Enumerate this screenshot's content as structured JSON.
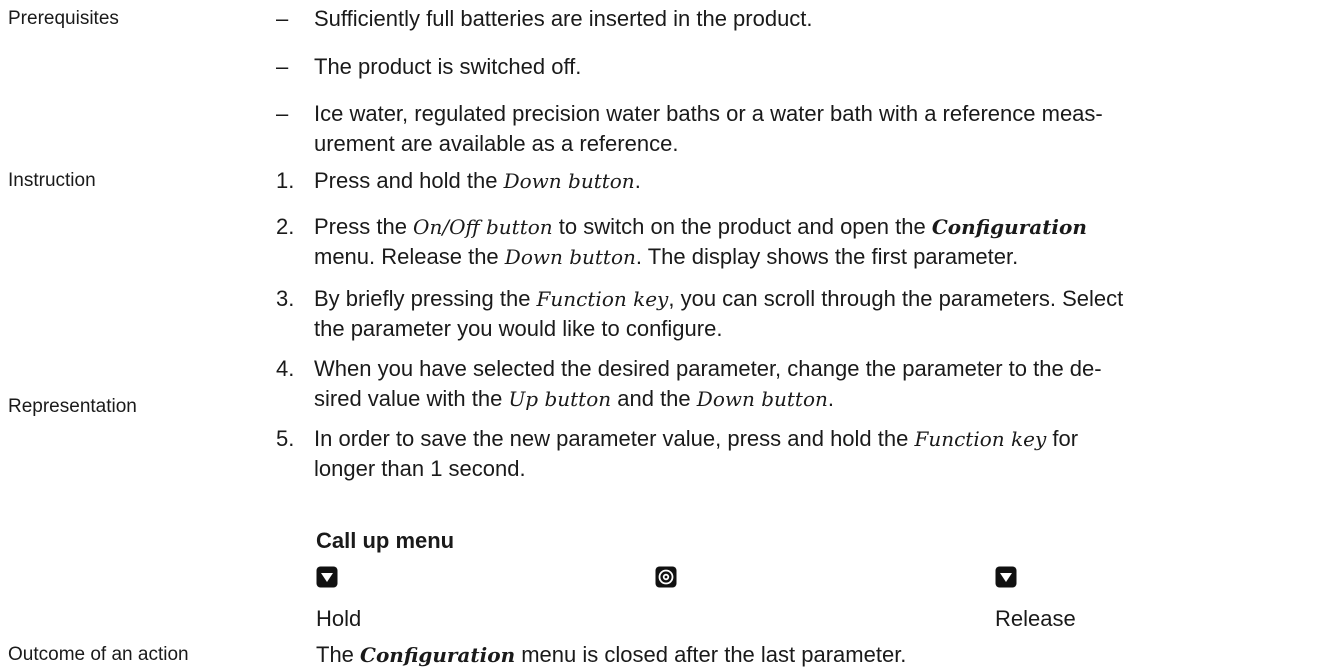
{
  "sections": {
    "prerequisites_label": "Prerequisites",
    "instruction_label": "Instruction",
    "representation_label": "Representation",
    "outcome_label": "Outcome of an action"
  },
  "prerequisites": [
    {
      "marker": "–",
      "text": "Sufficiently full batteries are inserted in the product."
    },
    {
      "marker": "–",
      "text": "The product is switched off."
    },
    {
      "marker": "–",
      "line1": "Ice water, regulated precision water baths or a water bath with a reference meas-",
      "line2": "urement are available as a reference."
    }
  ],
  "steps": [
    {
      "num": "1.",
      "a": "Press and hold the ",
      "b": "Down button",
      "c": "."
    },
    {
      "num": "2.",
      "a": "Press the ",
      "b": "On/Off button",
      "c": " to switch on the product and open the ",
      "d": "Configuration",
      "e": "menu. Release the ",
      "f": "Down button",
      "g": ". The display shows the first parameter."
    },
    {
      "num": "3.",
      "a": "By briefly pressing the ",
      "b": "Function key",
      "c": ", you can scroll through the parameters. Select",
      "d": "the parameter you would like to configure."
    },
    {
      "num": "4.",
      "a": "When you have selected the desired parameter, change the parameter to the de-",
      "b": "sired value with the ",
      "c": "Up button",
      "d": " and the ",
      "e": "Down button",
      "f": "."
    },
    {
      "num": "5.",
      "a": "In order to save the new parameter value, press and hold the ",
      "b": "Function key",
      "c": " for",
      "d": "longer than 1 second."
    }
  ],
  "representation": {
    "heading": "Call up menu",
    "icons": [
      "down-button-icon",
      "on-off-button-icon",
      "down-button-icon"
    ],
    "hold": "Hold",
    "release": "Release"
  },
  "outcome": {
    "a": "The ",
    "b": "Configuration",
    "c": " menu is closed after the last parameter."
  }
}
